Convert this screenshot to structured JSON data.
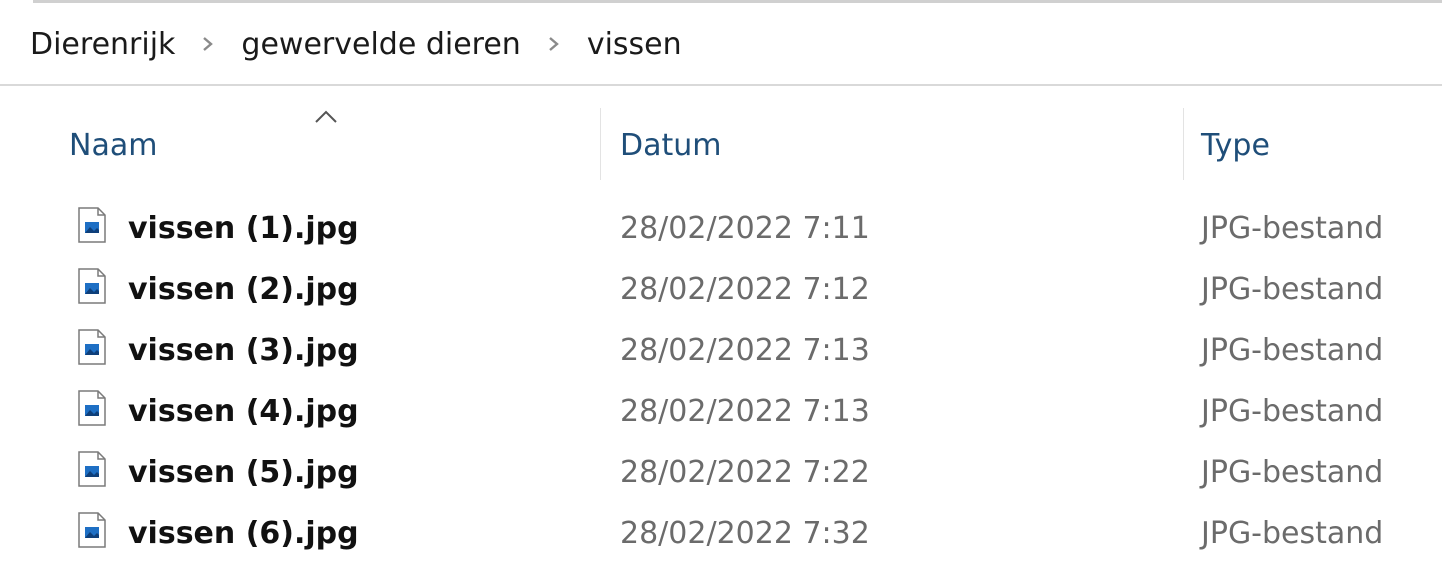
{
  "breadcrumb": {
    "items": [
      {
        "label": "Dierenrijk"
      },
      {
        "label": "gewervelde dieren"
      },
      {
        "label": "vissen"
      }
    ]
  },
  "columns": {
    "name": "Naam",
    "date": "Datum",
    "type": "Type"
  },
  "files": [
    {
      "name": "vissen (1).jpg",
      "date": "28/02/2022 7:11",
      "type": "JPG-bestand"
    },
    {
      "name": "vissen (2).jpg",
      "date": "28/02/2022 7:12",
      "type": "JPG-bestand"
    },
    {
      "name": "vissen (3).jpg",
      "date": "28/02/2022 7:13",
      "type": "JPG-bestand"
    },
    {
      "name": "vissen (4).jpg",
      "date": "28/02/2022 7:13",
      "type": "JPG-bestand"
    },
    {
      "name": "vissen (5).jpg",
      "date": "28/02/2022 7:22",
      "type": "JPG-bestand"
    },
    {
      "name": "vissen (6).jpg",
      "date": "28/02/2022 7:32",
      "type": "JPG-bestand"
    }
  ],
  "colors": {
    "header_text": "#1f4e79",
    "secondary_text": "#6b6b6b",
    "icon_accent": "#1e6fc4"
  },
  "icons": {
    "sort": "chevron-up-icon",
    "breadcrumb_separator": "chevron-right-icon",
    "file": "image-file-icon"
  }
}
